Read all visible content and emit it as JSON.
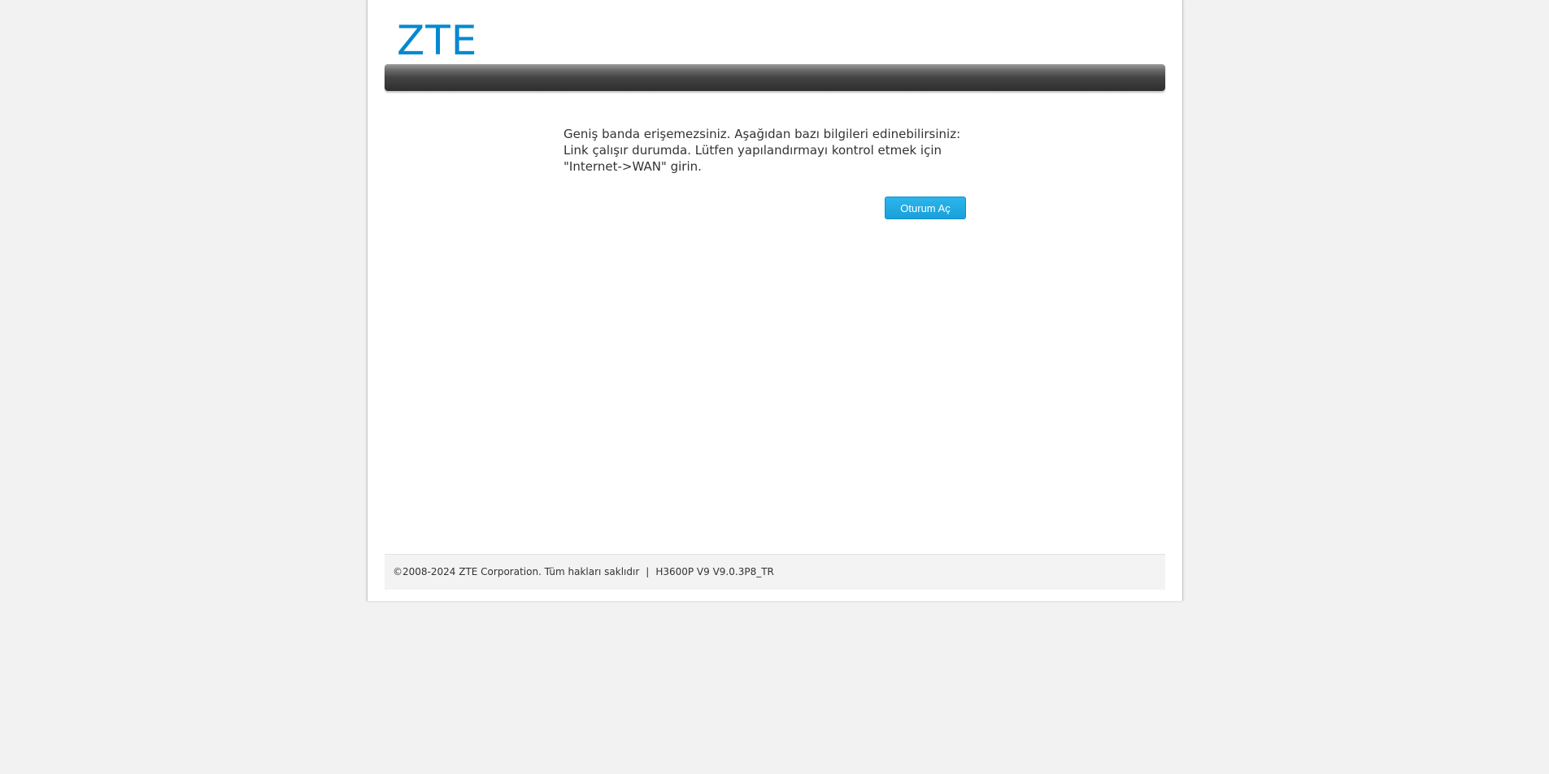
{
  "header": {
    "logo_text": "ZTE"
  },
  "main": {
    "message_line1": "Geniş banda erişemezsiniz. Aşağıdan bazı bilgileri edinebilirsiniz:",
    "message_line2": "Link çalışır durumda. Lütfen yapılandırmayı kontrol etmek için \"Internet->WAN\" girin.",
    "login_button": "Oturum Aç"
  },
  "footer": {
    "copyright": "©2008-2024 ZTE Corporation. Tüm hakları saklıdır",
    "separator": "|",
    "version": "H3600P V9 V9.0.3P8_TR"
  },
  "colors": {
    "brand": "#0089d1",
    "button": "#1a9fda"
  }
}
